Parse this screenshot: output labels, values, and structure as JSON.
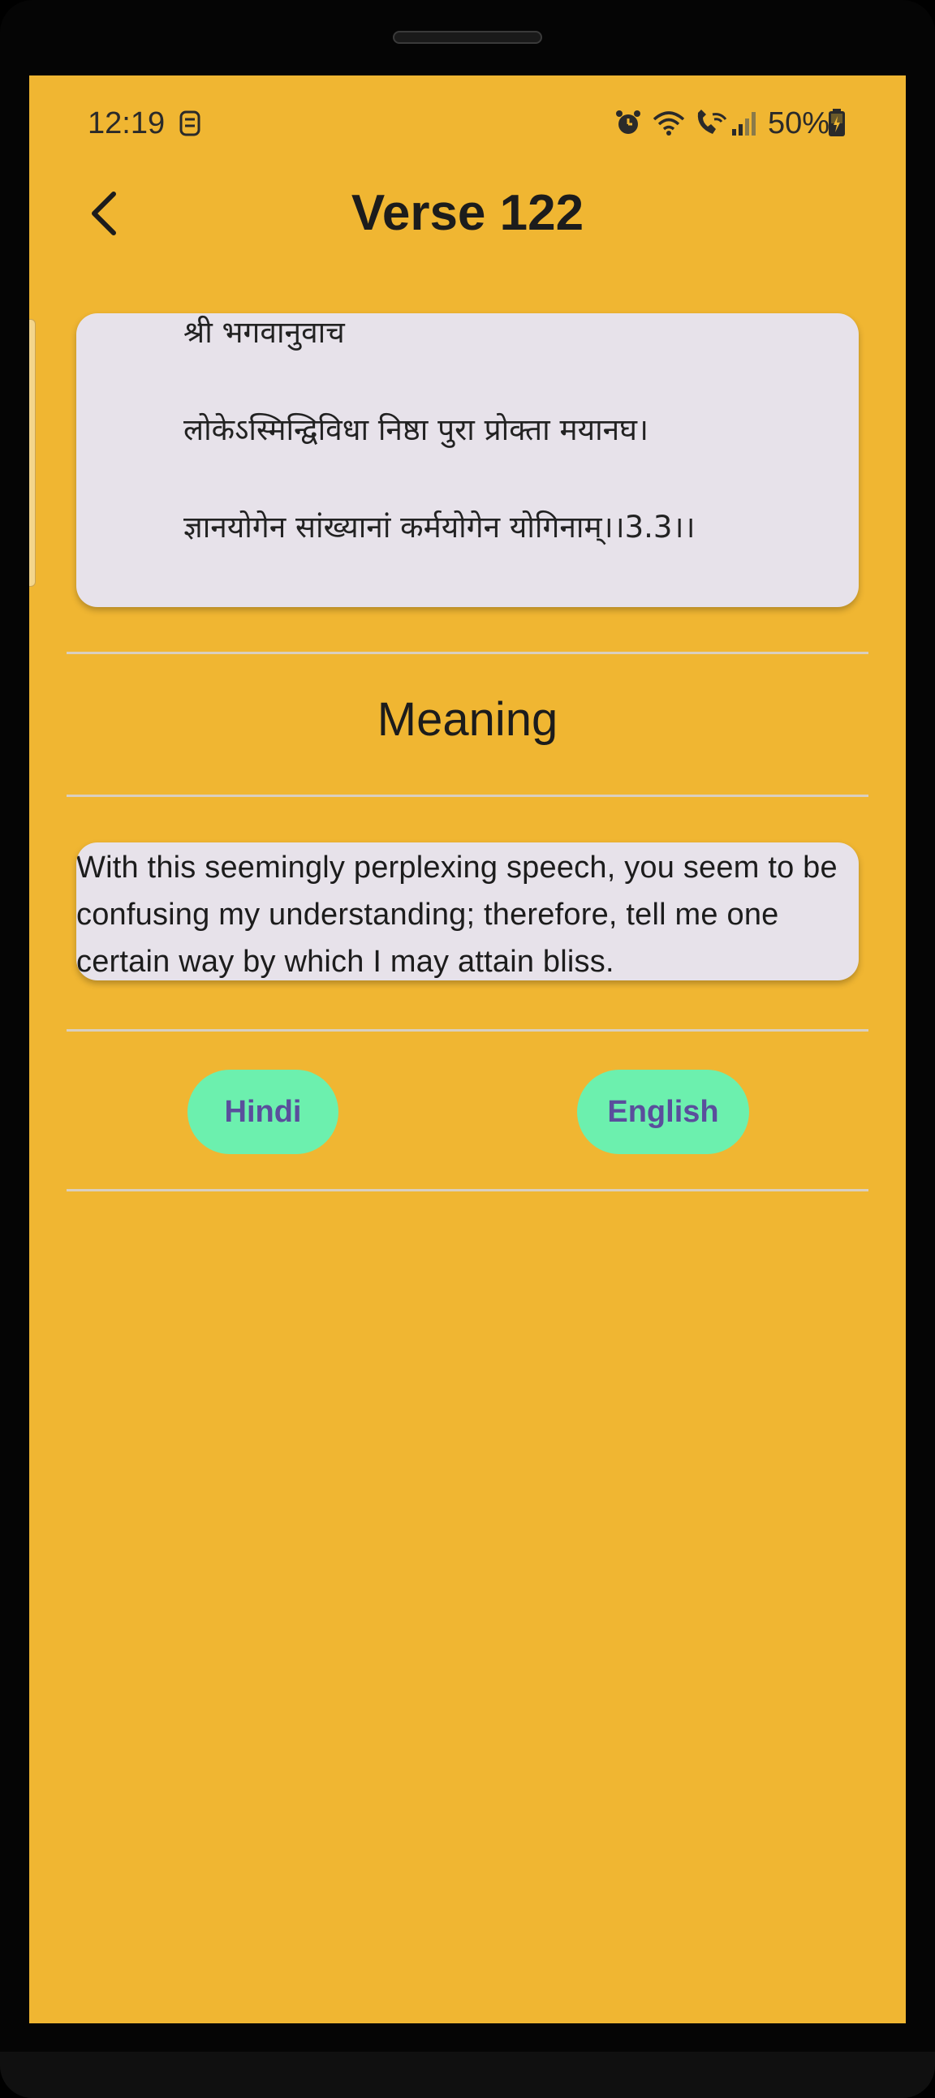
{
  "status_bar": {
    "time": "12:19",
    "battery": "50%",
    "icons": [
      "notification-icon",
      "alarm-icon",
      "wifi-icon",
      "wifi-call-icon",
      "signal-icon",
      "battery-icon"
    ]
  },
  "header": {
    "title": "Verse 122",
    "back_icon": "chevron-left-icon"
  },
  "verse": {
    "lines": [
      "श्री भगवानुवाच",
      "लोकेऽस्मिन्द्विविधा निष्ठा पुरा प्रोक्ता मयानघ।",
      "ज्ञानयोगेन सांख्यानां कर्मयोगेन योगिनाम्।।3.3।।"
    ]
  },
  "meaning": {
    "heading": "Meaning",
    "text": "With this seemingly perplexing speech, you seem to be confusing my understanding; therefore, tell me one certain way by which I may attain bliss."
  },
  "language_buttons": {
    "hindi": "Hindi",
    "english": "English"
  },
  "colors": {
    "background": "#F0B632",
    "card": "#E7E2EA",
    "button": "#6CF0AE",
    "button_text": "#5A4E9C"
  }
}
